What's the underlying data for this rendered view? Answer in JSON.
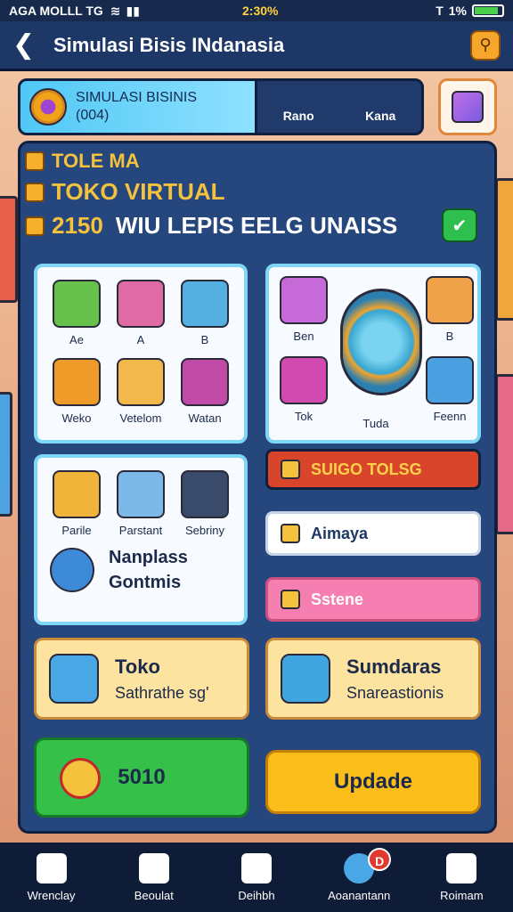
{
  "status_bar": {
    "carrier": "AGA MOLLL TG",
    "time": "2:30%",
    "signal": "T",
    "battery": "1%"
  },
  "header": {
    "title": "Simulasi Bisis INdanasia"
  },
  "banner": {
    "title": "SIMULASI BISINIS",
    "subtitle": "(004)",
    "tab1": "Rano",
    "tab2": "Kana"
  },
  "info": {
    "line1": "TOLE MA",
    "line2": "TOKO VIRTUAL",
    "line3_num": "2150",
    "line3_text": "WIU LEPIS EELG UNAISS"
  },
  "card1": {
    "items": [
      "Ae",
      "A",
      "B",
      "Weko",
      "Vetelom",
      "Watan"
    ]
  },
  "card2": {
    "items": [
      "Ben",
      "B",
      "Tok",
      "Tuda",
      "Feenn"
    ]
  },
  "card3": {
    "items": [
      "Parile",
      "Parstant",
      "Sebriny"
    ],
    "heading1": "Nanplass",
    "heading2": "Gontmis"
  },
  "actions": {
    "red": "SUIGO TOLSG",
    "white": "Aimaya",
    "pink": "Sstene"
  },
  "promo1": {
    "title": "Toko",
    "subtitle": "Sathrathe sg'"
  },
  "promo2": {
    "title": "Sumdaras",
    "subtitle": "Snareastionis"
  },
  "cta": {
    "green": "5010",
    "yellow": "Updade"
  },
  "nav": {
    "items": [
      "Wrenclay",
      "Beoulat",
      "Deihbh",
      "Aoanantann",
      "Roimam"
    ],
    "badge": "D"
  },
  "colors": {
    "header": "#1d3767",
    "panel": "#26477d",
    "accent_gold": "#f4c23c",
    "green": "#2fbf4f",
    "red": "#d9452a",
    "pink": "#f47fb0",
    "yellow": "#fbbd1a"
  }
}
